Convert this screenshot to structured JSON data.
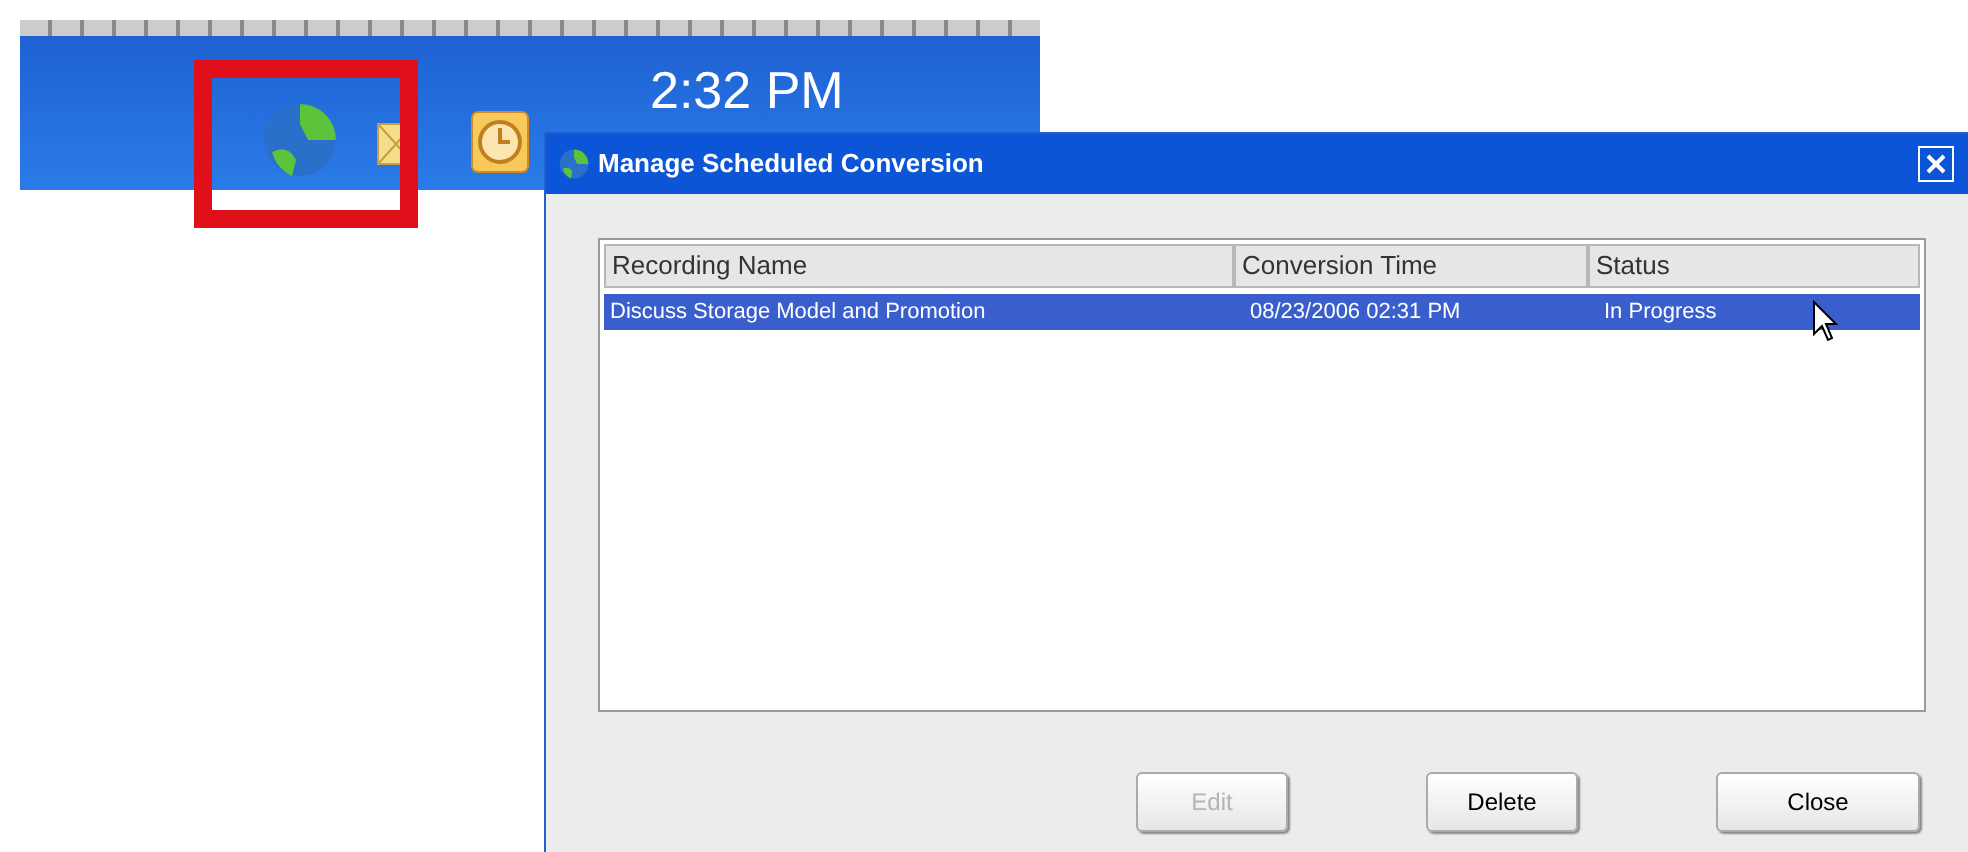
{
  "taskbar": {
    "clock": "2:32 PM",
    "highlighted_icon": true
  },
  "dialog": {
    "title": "Manage Scheduled Conversion",
    "table": {
      "columns": [
        "Recording Name",
        "Conversion Time",
        "Status"
      ],
      "rows": [
        {
          "cells": [
            "Discuss Storage Model and Promotion",
            "08/23/2006 02:31 PM",
            "In Progress"
          ],
          "selected": true
        }
      ]
    },
    "buttons": [
      {
        "label": "Edit",
        "disabled": true
      },
      {
        "label": "Delete",
        "disabled": false
      },
      {
        "label": "Close",
        "disabled": false
      }
    ]
  }
}
